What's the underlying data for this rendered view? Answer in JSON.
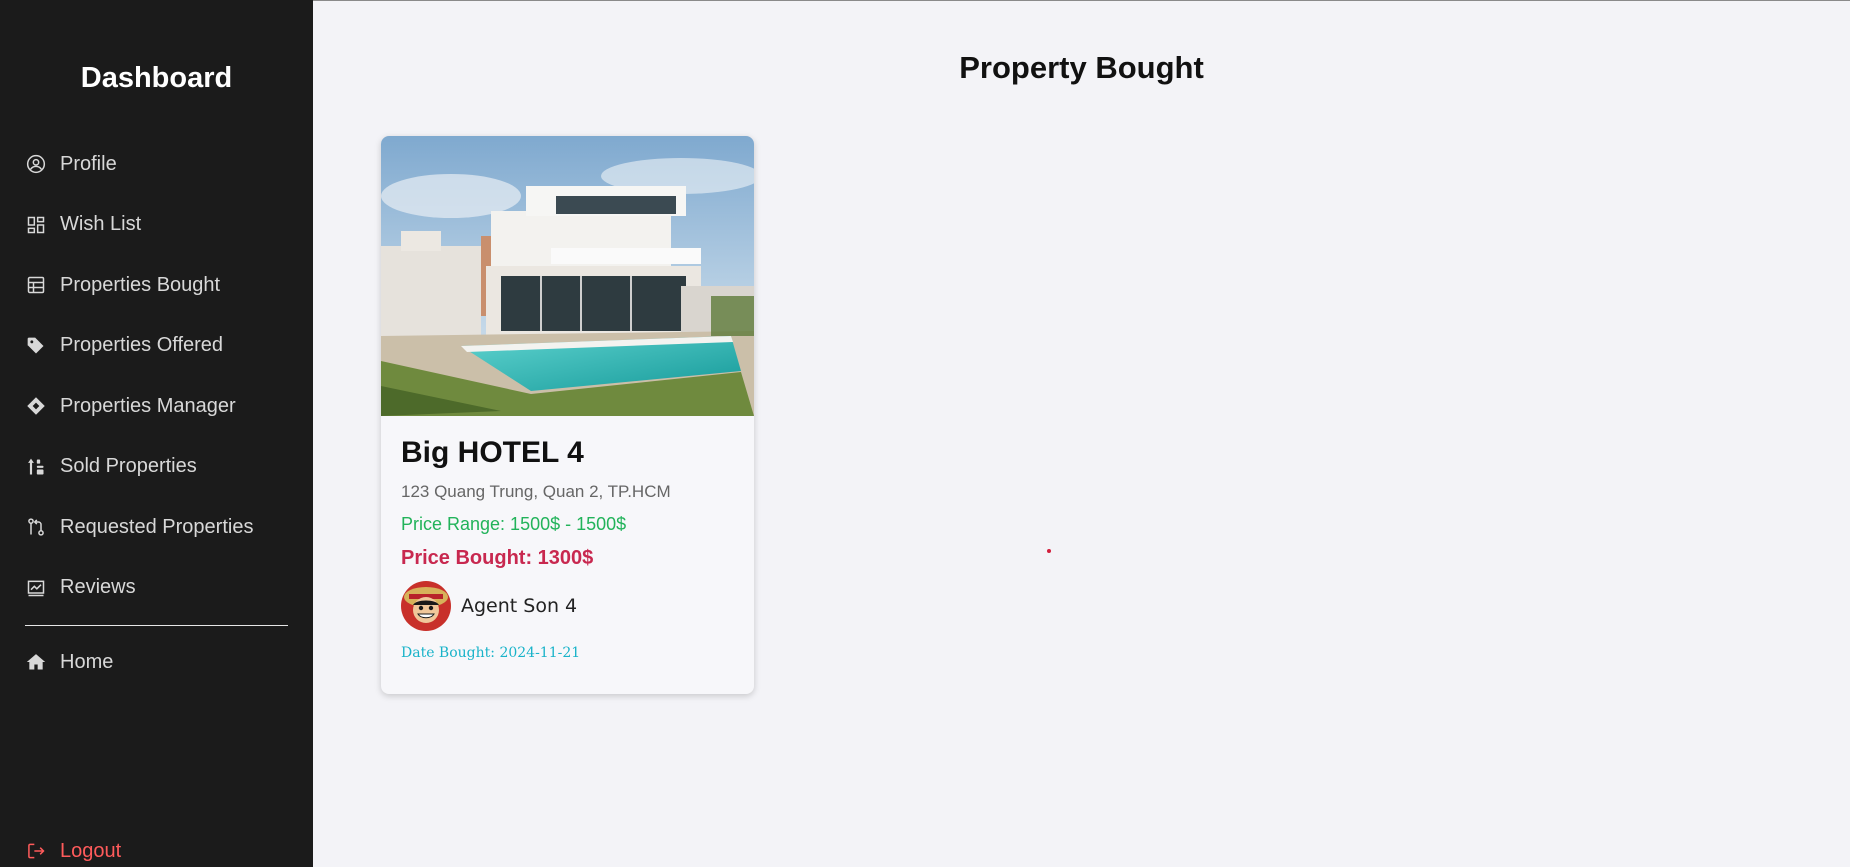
{
  "sidebar": {
    "brand": "Dashboard",
    "items": [
      {
        "label": "Profile",
        "icon": "user-circle-icon"
      },
      {
        "label": "Wish List",
        "icon": "dashboard-grid-icon"
      },
      {
        "label": "Properties Bought",
        "icon": "table-icon"
      },
      {
        "label": "Properties Offered",
        "icon": "tag-icon"
      },
      {
        "label": "Properties Manager",
        "icon": "diamond-icon"
      },
      {
        "label": "Sold Properties",
        "icon": "sort-icon"
      },
      {
        "label": "Requested Properties",
        "icon": "git-pull-request-icon"
      },
      {
        "label": "Reviews",
        "icon": "chart-card-icon"
      }
    ],
    "home": {
      "label": "Home",
      "icon": "home-icon"
    },
    "logout": {
      "label": "Logout",
      "icon": "logout-icon"
    }
  },
  "main": {
    "title": "Property Bought",
    "cards": [
      {
        "name": "Big HOTEL 4",
        "address": "123 Quang Trung, Quan 2, TP.HCM",
        "price_range": "Price Range: 1500$ - 1500$",
        "price_bought": "Price Bought: 1300$",
        "agent_name": "Agent Son 4",
        "date_bought": "Date Bought: 2024-11-21"
      }
    ]
  },
  "colors": {
    "sidebar_bg": "#1b1b1b",
    "page_bg": "#f3f3f7",
    "price_range": "#22b35a",
    "price_bought": "#c8284f",
    "date": "#19b3c9",
    "logout": "#ff5b5b"
  }
}
